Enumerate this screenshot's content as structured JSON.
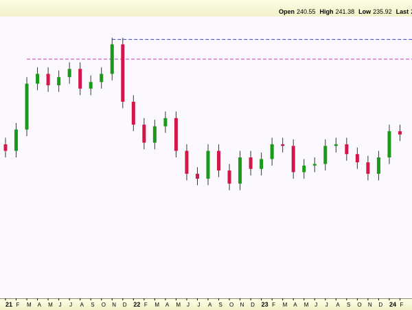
{
  "header": {
    "quote": [
      {
        "label": "Open",
        "value": "240.55"
      },
      {
        "label": "High",
        "value": "241.38"
      },
      {
        "label": "Low",
        "value": "235.92"
      },
      {
        "label": "Last",
        "value": "2"
      }
    ]
  },
  "colors": {
    "up": "#1a9a1a",
    "down": "#d4174a",
    "wick": "#333333",
    "line_high_blue": "#3a3acc",
    "line_high_magenta": "#cc33cc",
    "plot_bg": "#fbf9fd"
  },
  "chart_data": {
    "type": "candlestick",
    "title": "",
    "xlabel": "",
    "ylabel": "",
    "x_start": "2021-01",
    "x_end": "2024-03",
    "grid": false,
    "legend": "none",
    "x_ticks": [
      {
        "label": "21",
        "date": "2021-01",
        "year": true
      },
      {
        "label": "F",
        "date": "2021-02"
      },
      {
        "label": "M",
        "date": "2021-03"
      },
      {
        "label": "A",
        "date": "2021-04"
      },
      {
        "label": "M",
        "date": "2021-05"
      },
      {
        "label": "J",
        "date": "2021-06"
      },
      {
        "label": "J",
        "date": "2021-07"
      },
      {
        "label": "A",
        "date": "2021-08"
      },
      {
        "label": "S",
        "date": "2021-09"
      },
      {
        "label": "O",
        "date": "2021-10"
      },
      {
        "label": "N",
        "date": "2021-11"
      },
      {
        "label": "D",
        "date": "2021-12"
      },
      {
        "label": "22",
        "date": "2022-01",
        "year": true
      },
      {
        "label": "F",
        "date": "2022-02"
      },
      {
        "label": "M",
        "date": "2022-03"
      },
      {
        "label": "A",
        "date": "2022-04"
      },
      {
        "label": "M",
        "date": "2022-05"
      },
      {
        "label": "J",
        "date": "2022-06"
      },
      {
        "label": "J",
        "date": "2022-07"
      },
      {
        "label": "A",
        "date": "2022-08"
      },
      {
        "label": "S",
        "date": "2022-09"
      },
      {
        "label": "O",
        "date": "2022-10"
      },
      {
        "label": "N",
        "date": "2022-11"
      },
      {
        "label": "D",
        "date": "2022-12"
      },
      {
        "label": "23",
        "date": "2023-01",
        "year": true
      },
      {
        "label": "F",
        "date": "2023-02"
      },
      {
        "label": "M",
        "date": "2023-03"
      },
      {
        "label": "A",
        "date": "2023-04"
      },
      {
        "label": "M",
        "date": "2023-05"
      },
      {
        "label": "J",
        "date": "2023-06"
      },
      {
        "label": "J",
        "date": "2023-07"
      },
      {
        "label": "A",
        "date": "2023-08"
      },
      {
        "label": "S",
        "date": "2023-09"
      },
      {
        "label": "O",
        "date": "2023-10"
      },
      {
        "label": "N",
        "date": "2023-11"
      },
      {
        "label": "D",
        "date": "2023-12"
      },
      {
        "label": "24",
        "date": "2024-01",
        "year": true
      },
      {
        "label": "F",
        "date": "2024-02"
      }
    ],
    "candles": [
      {
        "date": "2021-01",
        "close": 180
      },
      {
        "date": "2021-02",
        "close": 193
      },
      {
        "date": "2021-03",
        "close": 221
      },
      {
        "date": "2021-04",
        "close": 227
      },
      {
        "date": "2021-05",
        "close": 220
      },
      {
        "date": "2021-06",
        "close": 225
      },
      {
        "date": "2021-07",
        "close": 230
      },
      {
        "date": "2021-08",
        "close": 218
      },
      {
        "date": "2021-09",
        "close": 222
      },
      {
        "date": "2021-10",
        "close": 227
      },
      {
        "date": "2021-11",
        "close": 245
      },
      {
        "date": "2021-12",
        "close": 210
      },
      {
        "date": "2022-01",
        "close": 196
      },
      {
        "date": "2022-02",
        "close": 185
      },
      {
        "date": "2022-03",
        "close": 195
      },
      {
        "date": "2022-04",
        "close": 200
      },
      {
        "date": "2022-05",
        "close": 180
      },
      {
        "date": "2022-06",
        "close": 166
      },
      {
        "date": "2022-07",
        "close": 163
      },
      {
        "date": "2022-08",
        "close": 180
      },
      {
        "date": "2022-09",
        "close": 168
      },
      {
        "date": "2022-10",
        "close": 160
      },
      {
        "date": "2022-11",
        "close": 176
      },
      {
        "date": "2022-12",
        "close": 169
      },
      {
        "date": "2023-01",
        "close": 175
      },
      {
        "date": "2023-02",
        "close": 184
      },
      {
        "date": "2023-03",
        "close": 183
      },
      {
        "date": "2023-04",
        "close": 167
      },
      {
        "date": "2023-05",
        "close": 171
      },
      {
        "date": "2023-06",
        "close": 172
      },
      {
        "date": "2023-07",
        "close": 183
      },
      {
        "date": "2023-08",
        "close": 184
      },
      {
        "date": "2023-09",
        "close": 178
      },
      {
        "date": "2023-10",
        "close": 173
      },
      {
        "date": "2023-11",
        "close": 166
      },
      {
        "date": "2023-12",
        "close": 176
      },
      {
        "date": "2024-01",
        "close": 192
      },
      {
        "date": "2024-02",
        "close": 190
      }
    ],
    "reference_lines": [
      {
        "name": "high-blue",
        "value": 248
      },
      {
        "name": "high-magenta",
        "value": 236
      }
    ],
    "ylim": [
      90,
      262
    ]
  }
}
